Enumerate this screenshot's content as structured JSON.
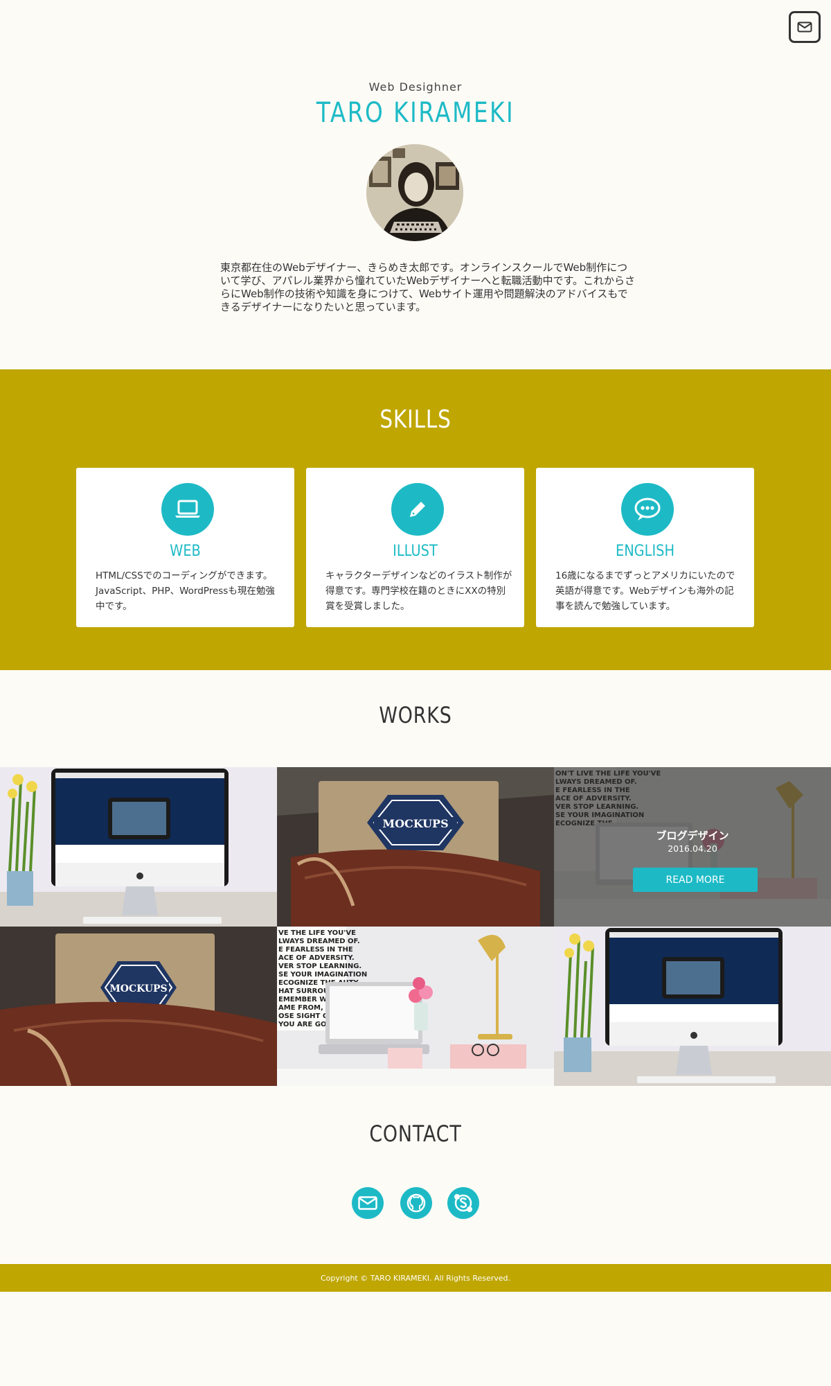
{
  "header": {
    "mail_icon": "mail-icon"
  },
  "profile": {
    "role": "Web Desighner",
    "name": "TARO KIRAMEKI",
    "bio": "東京都在住のWebデザイナー、きらめき太郎です。オンラインスクールでWeb制作について学び、アパレル業界から憧れていたWebデザイナーへと転職活動中です。これからさらにWeb制作の技術や知識を身につけて、Webサイト運用や問題解決のアドバイスもできるデザイナーになりたいと思っています。"
  },
  "skills": {
    "title": "SKILLS",
    "items": [
      {
        "icon": "laptop-icon",
        "title": "WEB",
        "text": "HTML/CSSでのコーディングができます。JavaScript、PHP、WordPressも現在勉強中です。"
      },
      {
        "icon": "pencil-icon",
        "title": "ILLUST",
        "text": "キャラクターデザインなどのイラスト制作が得意です。専門学校在籍のときにXXの特別賞を受賞しました。"
      },
      {
        "icon": "chat-bubble-icon",
        "title": "ENGLISH",
        "text": "16歳になるまでずっとアメリカにいたので英語が得意です。Webデザインも海外の記事を読んで勉強しています。"
      }
    ]
  },
  "works": {
    "title": "WORKS",
    "hover": {
      "title": "ブログデザイン",
      "date": "2016.04.20",
      "button": "READ MORE"
    }
  },
  "contact": {
    "title": "CONTACT",
    "icons": [
      "mail-icon",
      "github-icon",
      "skype-icon"
    ]
  },
  "footer": {
    "copyright": "Copyright © TARO KIRAMEKI. All Rights Reserved."
  },
  "colors": {
    "accent": "#1dbac6",
    "olive": "#bfa600",
    "background": "#fcfbf6"
  }
}
